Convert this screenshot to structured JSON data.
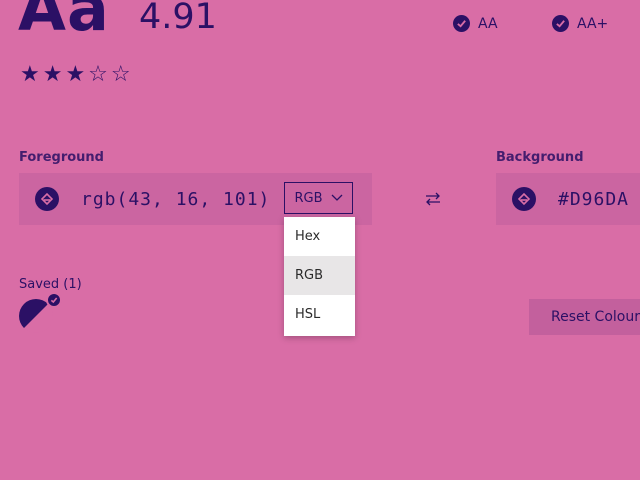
{
  "result": {
    "sample_text": "Aa",
    "contrast_ratio": "4.91",
    "rating": 3,
    "stars": "★★★☆☆",
    "checks": [
      "AA",
      "AA+"
    ]
  },
  "foreground": {
    "label": "Foreground",
    "value": "rgb(43, 16, 101)",
    "format": "RGB",
    "icon": "paint-bucket-icon",
    "color": "#2B1065"
  },
  "format_menu": {
    "options": [
      "Hex",
      "RGB",
      "HSL"
    ],
    "selected": "RGB"
  },
  "background": {
    "label": "Background",
    "value": "#D96DA",
    "icon": "paint-bucket-icon",
    "color": "#D96DA6"
  },
  "saved": {
    "label": "Saved (1)"
  },
  "actions": {
    "reset_label": "Reset Colour"
  }
}
